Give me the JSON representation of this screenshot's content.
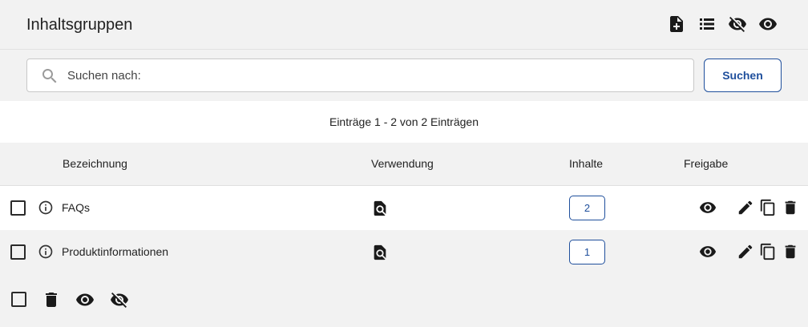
{
  "header": {
    "title": "Inhaltsgruppen",
    "icons": [
      "add-document-icon",
      "list-icon",
      "visibility-off-icon",
      "visibility-icon"
    ]
  },
  "search": {
    "placeholder": "Suchen nach:",
    "value": "",
    "button_label": "Suchen"
  },
  "summary": {
    "text": "Einträge 1 - 2 von 2 Einträgen"
  },
  "table": {
    "columns": [
      "Bezeichnung",
      "Verwendung",
      "Inhalte",
      "Freigabe"
    ],
    "rows": [
      {
        "name": "FAQs",
        "count": "2",
        "checked": false
      },
      {
        "name": "Produktinformationen",
        "count": "1",
        "checked": false
      }
    ],
    "row_icons": [
      "info-icon",
      "usage-search-icon",
      "visibility-icon",
      "edit-icon",
      "copy-icon",
      "delete-icon"
    ]
  },
  "footer": {
    "icons": [
      "delete-icon",
      "visibility-icon",
      "visibility-off-icon"
    ]
  },
  "colors": {
    "accent": "#1f4f9c",
    "background": "#f2f2f2",
    "surface": "#ffffff"
  }
}
